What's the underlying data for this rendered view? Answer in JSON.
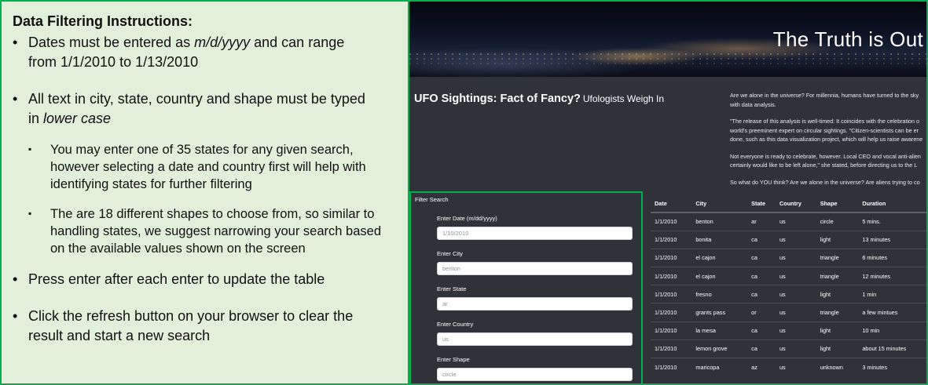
{
  "instructions": {
    "title": "Data Filtering Instructions:",
    "bullet_glyph": "•",
    "sub_bullet_glyph": "▪",
    "items": [
      {
        "lines": [
          {
            "parts": [
              {
                "text": "Dates must be entered as ",
                "italic": false
              },
              {
                "text": "m/d/yyyy",
                "italic": true
              },
              {
                "text": " and can range",
                "italic": false
              }
            ]
          },
          {
            "parts": [
              {
                "text": "from 1/1/2010 to 1/13/2010",
                "italic": false
              }
            ]
          }
        ]
      },
      {
        "lines": [
          {
            "parts": [
              {
                "text": "All text in city, state, country and shape must be typed",
                "italic": false
              }
            ]
          },
          {
            "parts": [
              {
                "text": "in ",
                "italic": false
              },
              {
                "text": "lower case",
                "italic": true
              }
            ]
          }
        ]
      },
      {
        "sub": true,
        "lines": [
          {
            "parts": [
              {
                "text": "You may enter one of 35 states for any given search,",
                "italic": false
              }
            ]
          },
          {
            "parts": [
              {
                "text": "however selecting a date and country first will help with",
                "italic": false
              }
            ]
          },
          {
            "parts": [
              {
                "text": "identifying states for further filtering",
                "italic": false
              }
            ]
          }
        ]
      },
      {
        "sub": true,
        "lines": [
          {
            "parts": [
              {
                "text": "The are 18 different shapes to choose from, so similar to",
                "italic": false
              }
            ]
          },
          {
            "parts": [
              {
                "text": "handling states, we suggest narrowing your search based",
                "italic": false
              }
            ]
          },
          {
            "parts": [
              {
                "text": "on the available values shown on the screen",
                "italic": false
              }
            ]
          }
        ]
      },
      {
        "lines": [
          {
            "parts": [
              {
                "text": "Press enter after each enter to update the table",
                "italic": false
              }
            ]
          }
        ]
      },
      {
        "lines": [
          {
            "parts": [
              {
                "text": "Click the refresh button on your browser to clear the",
                "italic": false
              }
            ]
          },
          {
            "parts": [
              {
                "text": "result and start a new search",
                "italic": false
              }
            ]
          }
        ]
      }
    ]
  },
  "page": {
    "hero_title": "The Truth is Out",
    "subtitle": "UFO Sightings: Fact of Fancy?",
    "subtitle_small": "Ufologists Weigh In",
    "article": [
      "Are we alone in the universe? For millennia, humans have turned to the sky",
      "with data analysis.",
      "\"The release of this analysis is well-timed: It coincides with the celebration o",
      "world's preeminent expert on circular sightings. \"Citizen-scientists can be er",
      "done, such as this data visualization project, which will help us raise awarene",
      "Not everyone is ready to celebrate, however. Local CEO and vocal anti-alien",
      "certainly would like to be left alone,\" she stated, before directing us to the L",
      "So what do YOU think? Are we alone in the universe? Are aliens trying to co"
    ]
  },
  "filters": {
    "title": "Filter Search",
    "fields": [
      {
        "label": "Enter Date (m/dd/yyyy)",
        "placeholder": "1/10/2010"
      },
      {
        "label": "Enter City",
        "placeholder": "benton"
      },
      {
        "label": "Enter State",
        "placeholder": "ar"
      },
      {
        "label": "Enter Country",
        "placeholder": "us"
      },
      {
        "label": "Enter Shape",
        "placeholder": "circle"
      }
    ]
  },
  "table": {
    "headers": [
      "Date",
      "City",
      "State",
      "Country",
      "Shape",
      "Duration"
    ],
    "rows": [
      [
        "1/1/2010",
        "benton",
        "ar",
        "us",
        "circle",
        "5 mins."
      ],
      [
        "1/1/2010",
        "bonita",
        "ca",
        "us",
        "light",
        "13 minutes"
      ],
      [
        "1/1/2010",
        "el cajon",
        "ca",
        "us",
        "triangle",
        "6 minutes"
      ],
      [
        "1/1/2010",
        "el cajon",
        "ca",
        "us",
        "triangle",
        "12 minutes"
      ],
      [
        "1/1/2010",
        "fresno",
        "ca",
        "us",
        "light",
        "1 min"
      ],
      [
        "1/1/2010",
        "grants pass",
        "or",
        "us",
        "triangle",
        "a few mintues"
      ],
      [
        "1/1/2010",
        "la mesa",
        "ca",
        "us",
        "light",
        "10 min"
      ],
      [
        "1/1/2010",
        "lemon grove",
        "ca",
        "us",
        "light",
        "about 15 minutes"
      ],
      [
        "1/1/2010",
        "maricopa",
        "az",
        "us",
        "unknown",
        "3 minutes"
      ]
    ]
  }
}
